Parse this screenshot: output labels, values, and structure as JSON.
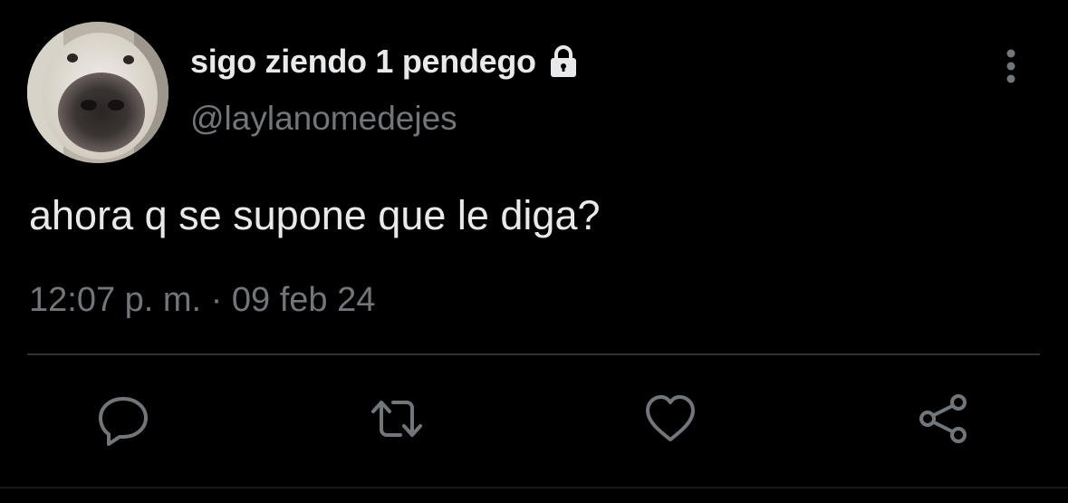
{
  "tweet": {
    "display_name": "sigo ziendo 1 pendego",
    "handle": "@laylanomedejes",
    "text": "ahora q se supone que le diga?",
    "time": "12:07 p. m.",
    "separator": "·",
    "date": "09 feb 24"
  },
  "icons": {
    "lock": "lock-icon",
    "more": "more-vertical-icon",
    "reply": "reply-icon",
    "retweet": "retweet-icon",
    "like": "heart-icon",
    "share": "share-icon"
  },
  "colors": {
    "background": "#000000",
    "primary_text": "#e7e9ea",
    "secondary_text": "#71767b",
    "divider": "#2f3336"
  }
}
